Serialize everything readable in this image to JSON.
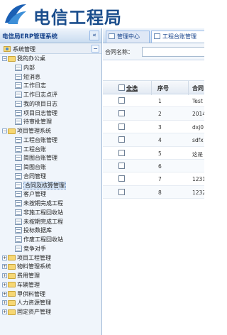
{
  "header": {
    "title": "电信工程局",
    "logo_icon": "telecom-logo-icon",
    "brand_color": "#1a4d8c"
  },
  "sidebar": {
    "title": "电信局ERP管理系统",
    "collapse_label": "«",
    "root_label": "系统管理",
    "root_collapse_label": "−",
    "tree": [
      {
        "label": "我的办公桌",
        "type": "folder",
        "expanded": true,
        "level": 1
      },
      {
        "label": "内部",
        "type": "doc",
        "level": 2
      },
      {
        "label": "短消息",
        "type": "doc",
        "level": 2
      },
      {
        "label": "工作日志",
        "type": "doc",
        "level": 2
      },
      {
        "label": "工作日志点评",
        "type": "doc",
        "level": 2
      },
      {
        "label": "我的项目日志",
        "type": "doc",
        "level": 2
      },
      {
        "label": "项目日志管理",
        "type": "doc",
        "level": 2
      },
      {
        "label": "待审批管理",
        "type": "doc",
        "level": 2
      },
      {
        "label": "项目管理系统",
        "type": "folder",
        "expanded": true,
        "level": 1
      },
      {
        "label": "工程台账管理",
        "type": "doc",
        "level": 2
      },
      {
        "label": "工程台账",
        "type": "doc",
        "level": 2
      },
      {
        "label": "简图台账管理",
        "type": "doc",
        "level": 2
      },
      {
        "label": "简图台账",
        "type": "doc",
        "level": 2
      },
      {
        "label": "合同管理",
        "type": "doc",
        "level": 2
      },
      {
        "label": "合同及核算管理",
        "type": "doc",
        "level": 2,
        "selected": true
      },
      {
        "label": "客户管理",
        "type": "doc",
        "level": 2
      },
      {
        "label": "未按期完成工程",
        "type": "doc",
        "level": 2
      },
      {
        "label": "非施工程回收站",
        "type": "doc",
        "level": 2
      },
      {
        "label": "未按期完成工程",
        "type": "doc",
        "level": 2
      },
      {
        "label": "投标数据库",
        "type": "doc",
        "level": 2
      },
      {
        "label": "作废工程回收站",
        "type": "doc",
        "level": 2
      },
      {
        "label": "竞争对手",
        "type": "doc",
        "level": 2
      },
      {
        "label": "项目工程管理",
        "type": "folder",
        "expanded": false,
        "level": 1
      },
      {
        "label": "物料管理系统",
        "type": "folder",
        "expanded": false,
        "level": 1
      },
      {
        "label": "费用管理",
        "type": "folder",
        "expanded": false,
        "level": 1
      },
      {
        "label": "车辆管理",
        "type": "folder",
        "expanded": false,
        "level": 1
      },
      {
        "label": "甲供料管理",
        "type": "folder",
        "expanded": false,
        "level": 1
      },
      {
        "label": "人力资源管理",
        "type": "folder",
        "expanded": false,
        "level": 1
      },
      {
        "label": "固定资产管理",
        "type": "folder",
        "expanded": false,
        "level": 1
      }
    ]
  },
  "main": {
    "tabs": [
      {
        "label": "管理中心",
        "icon": "home-icon"
      },
      {
        "label": "工程台账管理",
        "icon": "grid-icon"
      }
    ],
    "search": {
      "contract_label": "合同名称：",
      "contract_value": ""
    },
    "grid": {
      "columns": {
        "select_all": "全选",
        "seq": "序号",
        "contract": "合同"
      },
      "rows": [
        {
          "seq": "1",
          "contract": "Test"
        },
        {
          "seq": "2",
          "contract": "2014"
        },
        {
          "seq": "3",
          "contract": "dxj0"
        },
        {
          "seq": "4",
          "contract": "sdfx"
        },
        {
          "seq": "5",
          "contract": "这是"
        },
        {
          "seq": "6",
          "contract": ""
        },
        {
          "seq": "7",
          "contract": "1231"
        },
        {
          "seq": "8",
          "contract": "1232"
        }
      ]
    }
  }
}
